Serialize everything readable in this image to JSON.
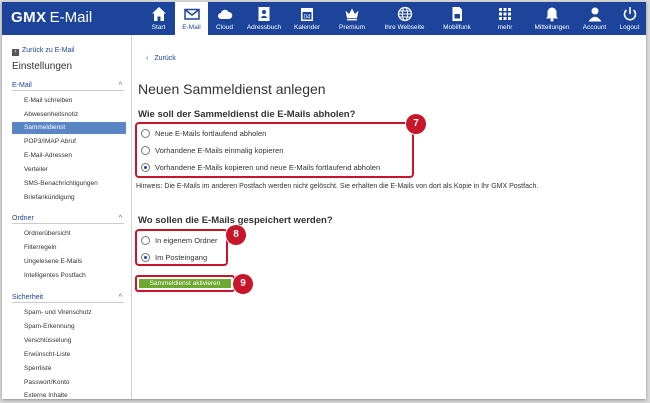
{
  "app": {
    "logo_brand": "GMX",
    "logo_product": "E-Mail"
  },
  "nav": [
    {
      "label": "Start",
      "icon": "home-icon",
      "active": false
    },
    {
      "label": "E-Mail",
      "icon": "envelope-icon",
      "active": true
    },
    {
      "label": "Cloud",
      "icon": "cloud-icon",
      "active": false
    },
    {
      "label": "Adressbuch",
      "icon": "addressbook-icon",
      "active": false
    },
    {
      "label": "Kalender",
      "icon": "calendar-icon",
      "active": false
    },
    {
      "label": "Premium",
      "icon": "crown-icon",
      "active": false
    },
    {
      "label": "Ihre Webseite",
      "icon": "globe-icon",
      "active": false
    },
    {
      "label": "Mobilfunk",
      "icon": "sim-card-icon",
      "active": false
    },
    {
      "label": "mehr",
      "icon": "grid-icon",
      "active": false
    },
    {
      "label": "Mitteilungen",
      "icon": "bell-icon",
      "active": false
    },
    {
      "label": "Account",
      "icon": "user-icon",
      "active": false
    },
    {
      "label": "Logout",
      "icon": "power-icon",
      "active": false
    }
  ],
  "calendar_day": "04",
  "sidebar": {
    "back_label": "Zurück zu E-Mail",
    "title": "Einstellungen",
    "sections": [
      {
        "title": "E-Mail",
        "items": [
          "E-Mail schreiben",
          "Abwesenheitsnotiz",
          "Sammeldienst",
          "POP3/IMAP Abruf",
          "E-Mail-Adressen",
          "Verteiler",
          "SMS-Benachrichtigungen",
          "Briefankündigung"
        ]
      },
      {
        "title": "Ordner",
        "items": [
          "Ordnerübersicht",
          "Filterregeln",
          "Ungelesene E-Mails",
          "Intelligentes Postfach"
        ]
      },
      {
        "title": "Sicherheit",
        "items": [
          "Spam- und Virenschutz",
          "Spam-Erkennung",
          "Verschlüsselung",
          "Erwünscht-Liste",
          "Sperrliste",
          "Passwort/Konto",
          "Externe Inhalte"
        ]
      }
    ],
    "active_item": "Sammeldienst"
  },
  "main": {
    "back_label": "Zurück",
    "title": "Neuen Sammeldienst anlegen",
    "question1": "Wie soll der Sammeldienst die E-Mails abholen?",
    "options1": [
      {
        "label": "Neue E-Mails fortlaufend abholen",
        "checked": false
      },
      {
        "label": "Vorhandene E-Mails einmalig kopieren",
        "checked": false
      },
      {
        "label": "Vorhandene E-Mails kopieren und neue E-Mails fortlaufend abholen",
        "checked": true
      }
    ],
    "hint": "Hinweis: Die E-Mails im anderen Postfach werden nicht gelöscht. Sie erhalten die E-Mails von dort als Kopie in Ihr GMX Postfach.",
    "question2": "Wo sollen die E-Mails gespeichert werden?",
    "options2": [
      {
        "label": "In eigenem Ordner",
        "checked": false
      },
      {
        "label": "Im Posteingang",
        "checked": true
      }
    ],
    "submit_label": "Sammeldienst aktivieren"
  },
  "badges": {
    "b1": "7",
    "b2": "8",
    "b3": "9"
  },
  "colors": {
    "nav_bg": "#1c449b",
    "highlight": "#c8152a",
    "button": "#6da82f",
    "active_item": "#5b86c5"
  }
}
